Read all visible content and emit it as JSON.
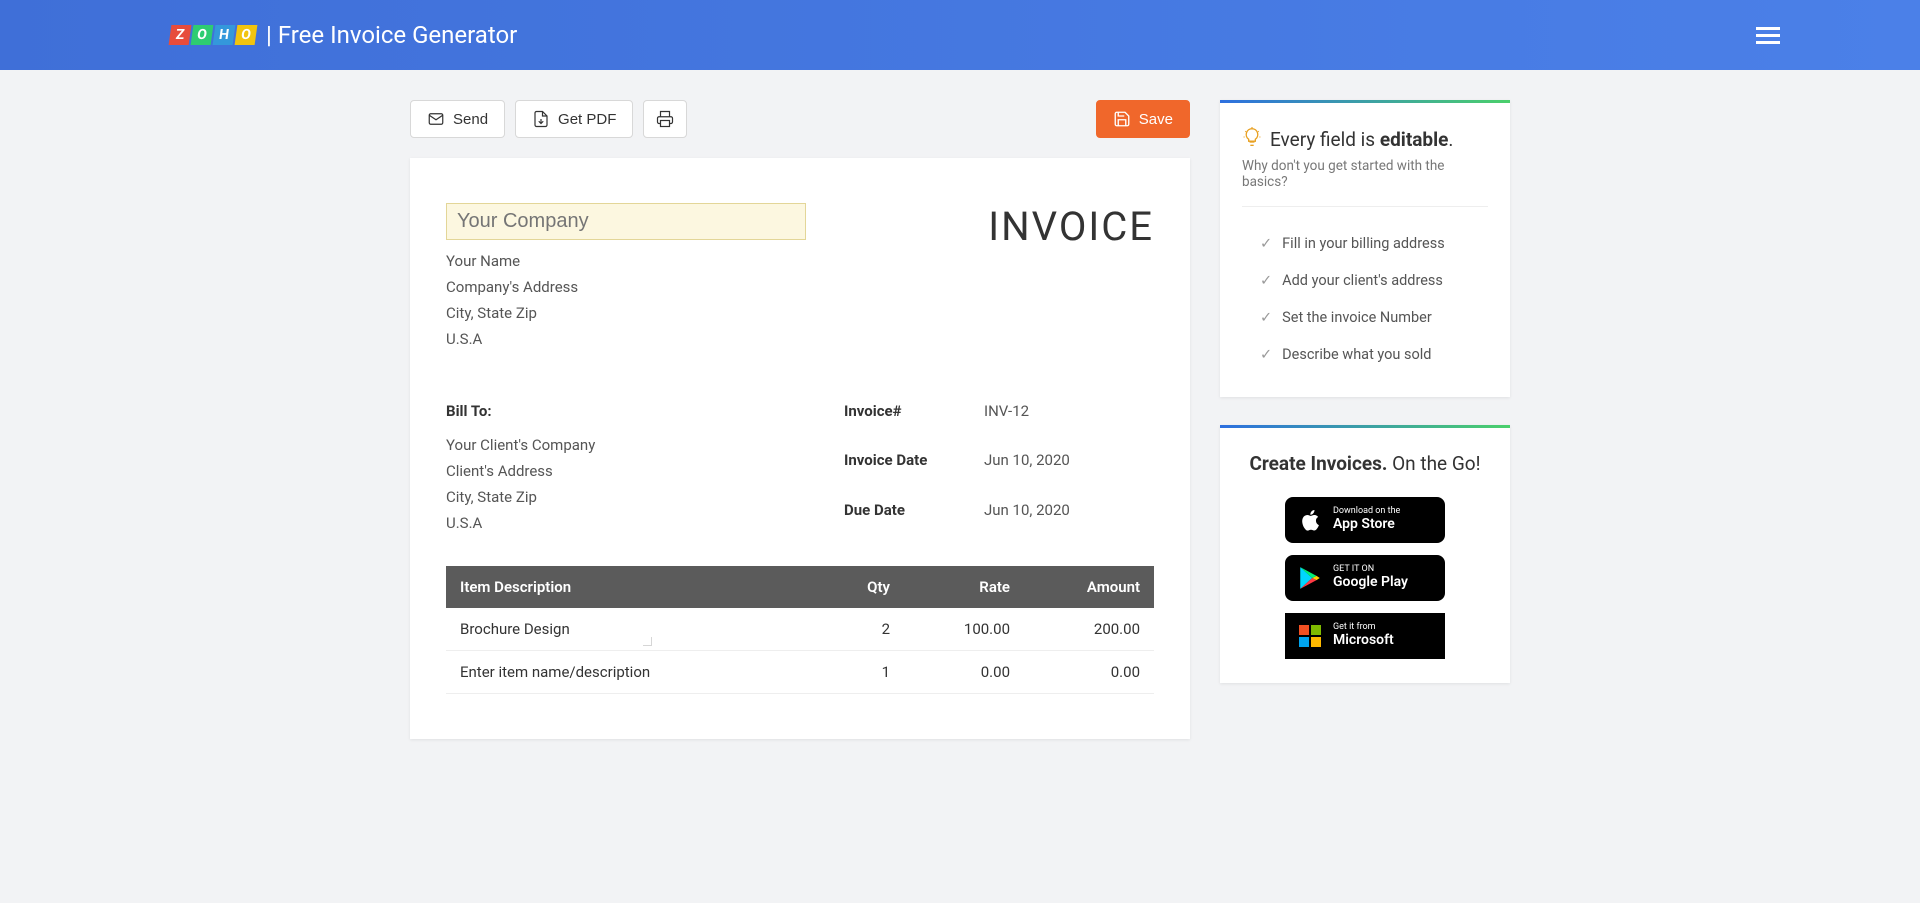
{
  "header": {
    "app_title": "| Free Invoice Generator"
  },
  "toolbar": {
    "send": "Send",
    "get_pdf": "Get PDF",
    "save": "Save"
  },
  "invoice": {
    "company_placeholder": "Your Company",
    "your_name": "Your Name",
    "company_address": "Company's Address",
    "city_state": "City, State Zip",
    "country": "U.S.A",
    "title": "INVOICE",
    "bill_to_label": "Bill To:",
    "client_company": "Your Client's Company",
    "client_address": "Client's Address",
    "client_city": "City, State Zip",
    "client_country": "U.S.A",
    "meta": {
      "invoice_no_label": "Invoice#",
      "invoice_no": "INV-12",
      "invoice_date_label": "Invoice Date",
      "invoice_date": "Jun 10, 2020",
      "due_date_label": "Due Date",
      "due_date": "Jun 10, 2020"
    },
    "columns": {
      "desc": "Item Description",
      "qty": "Qty",
      "rate": "Rate",
      "amount": "Amount"
    },
    "items": [
      {
        "desc": "Brochure Design",
        "qty": "2",
        "rate": "100.00",
        "amount": "200.00"
      }
    ],
    "new_item_placeholder": "Enter item name/description",
    "new_item_qty": "1",
    "new_item_rate": "0.00",
    "new_item_amount": "0.00"
  },
  "side": {
    "editable_title_prefix": "Every field is ",
    "editable_title_strong": "editable",
    "editable_title_suffix": ".",
    "editable_sub": "Why don't you get started with the basics?",
    "checks": [
      "Fill in your billing address",
      "Add your client's address",
      "Set the invoice Number",
      "Describe what you sold"
    ],
    "promo_title_strong": "Create Invoices.",
    "promo_title_rest": " On the Go!",
    "stores": {
      "apple_small": "Download on the",
      "apple_big": "App Store",
      "google_small": "GET IT ON",
      "google_big": "Google Play",
      "ms_small": "Get it from",
      "ms_big": "Microsoft"
    }
  }
}
